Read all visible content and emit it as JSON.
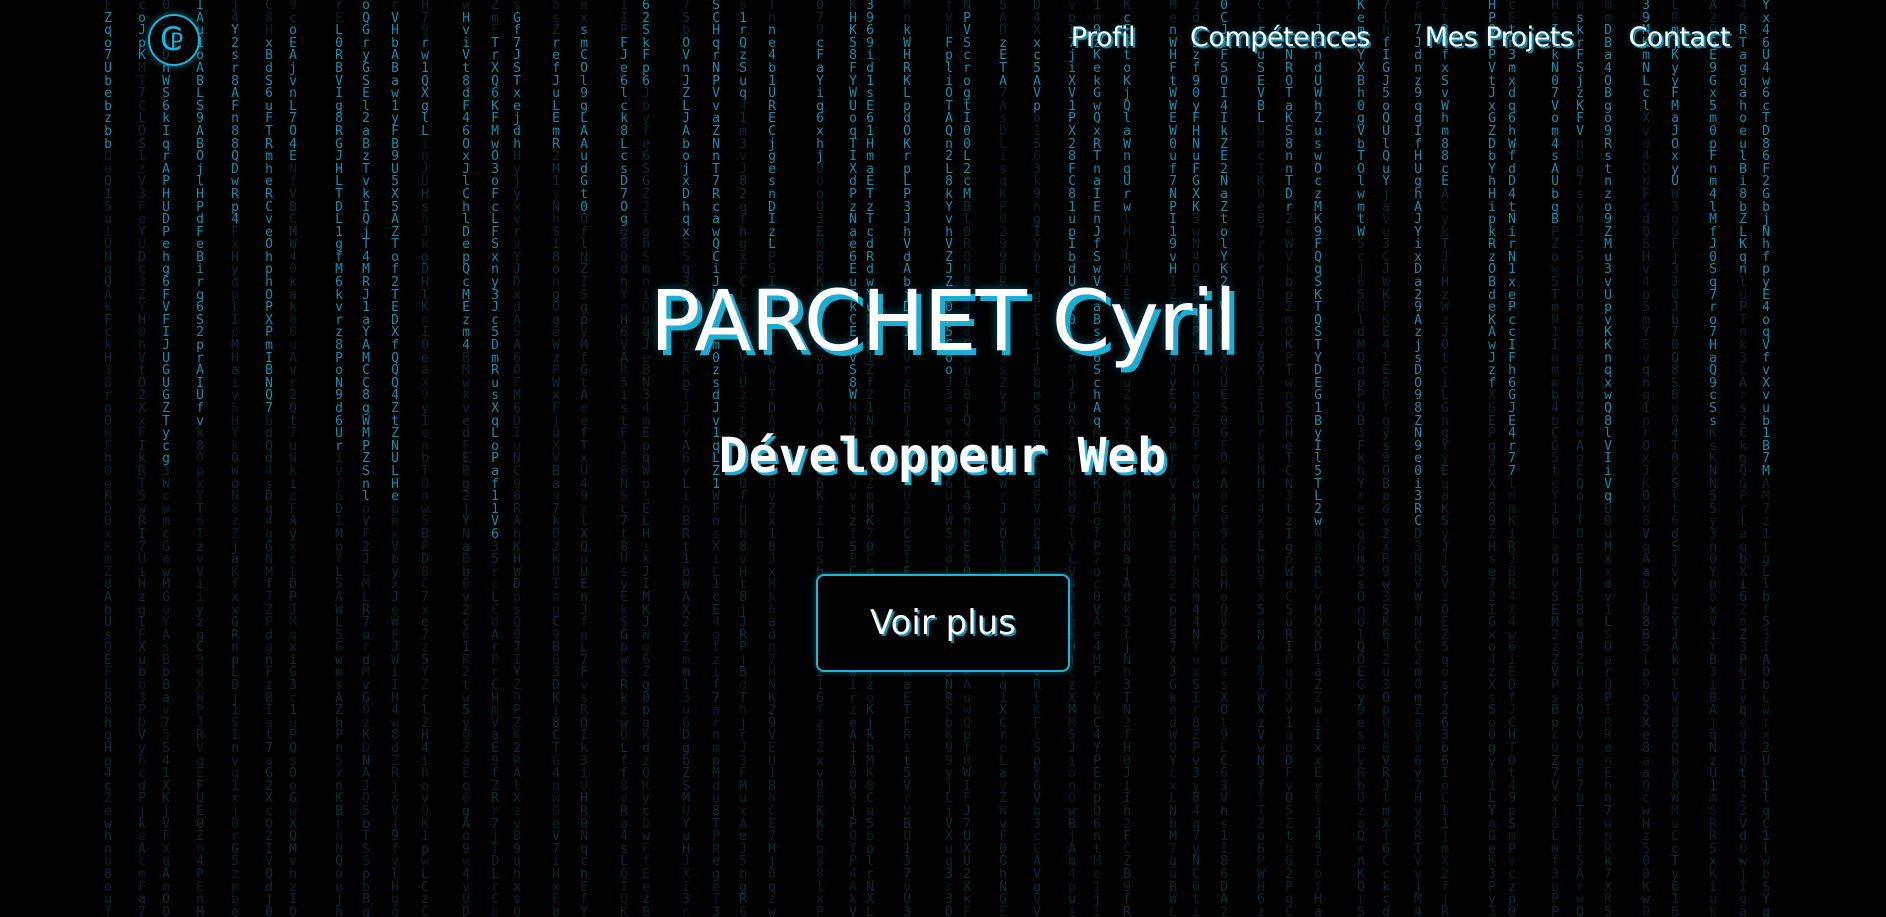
{
  "brand": {
    "logo_icon": "cp-monogram-logo",
    "logo_letter_outer": "C",
    "logo_letter_inner": "P"
  },
  "nav": {
    "items": [
      {
        "label": "Profil"
      },
      {
        "label": "Compétences"
      },
      {
        "label": "Mes Projets"
      },
      {
        "label": "Contact"
      }
    ]
  },
  "hero": {
    "title": "PARCHET Cyril",
    "subtitle": "Développeur Web",
    "button_label": "Voir plus"
  },
  "background": {
    "effect": "matrix-code-rain",
    "glyph_color": "#1fa3c8",
    "base_color": "#000000"
  },
  "theme": {
    "accent": "#1fb4d8",
    "text": "#ffffff"
  }
}
